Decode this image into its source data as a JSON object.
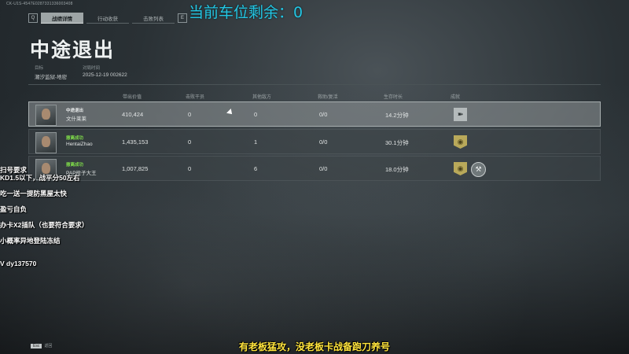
{
  "window": {
    "id_text": "CK-U1S-4547E0287331336003408"
  },
  "tabs": {
    "left_key": "Q",
    "right_key": "E",
    "items": [
      {
        "label": "战绩详情",
        "active": true
      },
      {
        "label": "行动收获",
        "active": false
      },
      {
        "label": "击败列表",
        "active": false
      }
    ]
  },
  "overlay": {
    "counter": "当前车位剩余：0"
  },
  "page": {
    "title": "中途退出"
  },
  "meta": {
    "target_label": "目标",
    "target_value": "潮汐监狱-地密",
    "time_label": "对局时间",
    "time_value": "2025-12-19 002622"
  },
  "table": {
    "headers": [
      "带出价值",
      "击败干员",
      "其他敌方",
      "救助/复活",
      "生存时长",
      "成就"
    ],
    "rows": [
      {
        "status": "中途退出",
        "status_color": "#e9ecec",
        "name": "文什莱莱",
        "value": "410,424",
        "kills": "0",
        "others": "0",
        "rescue": "0/0",
        "survive": "14.2分钟",
        "badges": [
          "grey"
        ]
      },
      {
        "status": "撤离成功",
        "status_color": "#7fdc4a",
        "name": "HentaiZhao",
        "value": "1,435,153",
        "kills": "0",
        "others": "1",
        "rescue": "0/0",
        "survive": "30.1分钟",
        "badges": [
          "gold"
        ]
      },
      {
        "status": "撤离成功",
        "status_color": "#7fdc4a",
        "name": "PAP役子大王",
        "value": "1,007,825",
        "kills": "0",
        "others": "6",
        "rescue": "0/0",
        "survive": "18.0分钟",
        "badges": [
          "gold",
          "round"
        ]
      }
    ]
  },
  "side_notes": [
    "扫号要求",
    "KD1.5以下，战平分50左右",
    "吃一送一提防黑屋太快",
    "盈亏自负",
    "办卡X2插队（也要符合要求）",
    "小概率异地登陆冻结",
    "V dy137570"
  ],
  "footer": {
    "key": "Esc",
    "key_label": "返回",
    "banner": "有老板猛攻，没老板卡战备跑刀养号"
  },
  "colors": {
    "overlay_text": "#24c6e3",
    "banner": "#ffe43c",
    "success": "#7fdc4a"
  }
}
